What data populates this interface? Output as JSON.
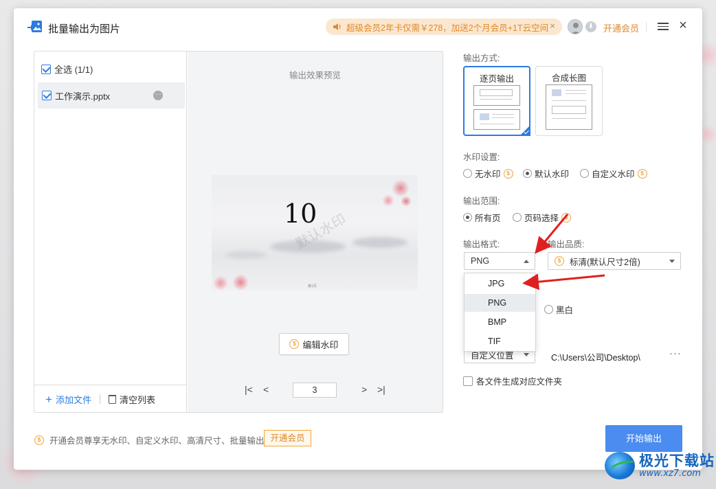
{
  "window": {
    "title": "批量输出为图片",
    "promo_text": "超级会员2年卡仅需￥278，加送2个月会员+1T云空间",
    "promo_close": "×",
    "vip_link": "开通会员",
    "close": "×"
  },
  "file_list": {
    "select_all": "全选 (1/1)",
    "files": [
      {
        "name": "工作演示.pptx",
        "more": "···"
      }
    ],
    "add_file": "添加文件",
    "add_icon": "+",
    "clear_list": "清空列表"
  },
  "preview": {
    "title": "输出效果预览",
    "slide_number": "10",
    "watermark": "默认水印",
    "slide_footer": "第1页",
    "edit_watermark": "编辑水印",
    "pager": {
      "first": "|<",
      "prev": "<",
      "page": "3",
      "next": ">",
      "last": ">|"
    }
  },
  "settings": {
    "output_mode_label": "输出方式:",
    "modes": [
      {
        "label": "逐页输出",
        "selected": true
      },
      {
        "label": "合成长图",
        "selected": false
      }
    ],
    "watermark_label": "水印设置:",
    "watermark_options": [
      {
        "label": "无水印",
        "selected": false,
        "vip": true
      },
      {
        "label": "默认水印",
        "selected": true,
        "vip": false
      },
      {
        "label": "自定义水印",
        "selected": false,
        "vip": true
      }
    ],
    "range_label": "输出范围:",
    "range_options": [
      {
        "label": "所有页",
        "selected": true,
        "vip": false
      },
      {
        "label": "页码选择",
        "selected": false,
        "vip": true
      }
    ],
    "format_label": "输出格式:",
    "format_value": "PNG",
    "format_options": [
      "JPG",
      "PNG",
      "BMP",
      "TIF"
    ],
    "format_highlighted": "PNG",
    "quality_label": "输出品质:",
    "quality_value": "标清(默认尺寸2倍)",
    "color_bw_label": "黑白",
    "save_location_value": "自定义位置",
    "save_path": "C:\\Users\\公司\\Desktop\\",
    "path_more": "···",
    "folder_option": "各文件生成对应文件夹"
  },
  "footer": {
    "vip_note": "开通会员尊享无水印、自定义水印、高清尺寸、批量输出",
    "vip_button": "开通会员",
    "start_button": "开始输出"
  },
  "brand": {
    "name": "极光下载站",
    "url": "www.xz7.com"
  },
  "colors": {
    "accent": "#2b7be0",
    "vip_orange": "#e0892a",
    "start_button": "#4a8cf0",
    "arrow": "#e02020"
  },
  "icons": {
    "app": "image-export-icon",
    "promo": "speaker-icon",
    "vip_coin": "coin-icon",
    "clear": "trash-icon",
    "menu": "hamburger-icon"
  }
}
